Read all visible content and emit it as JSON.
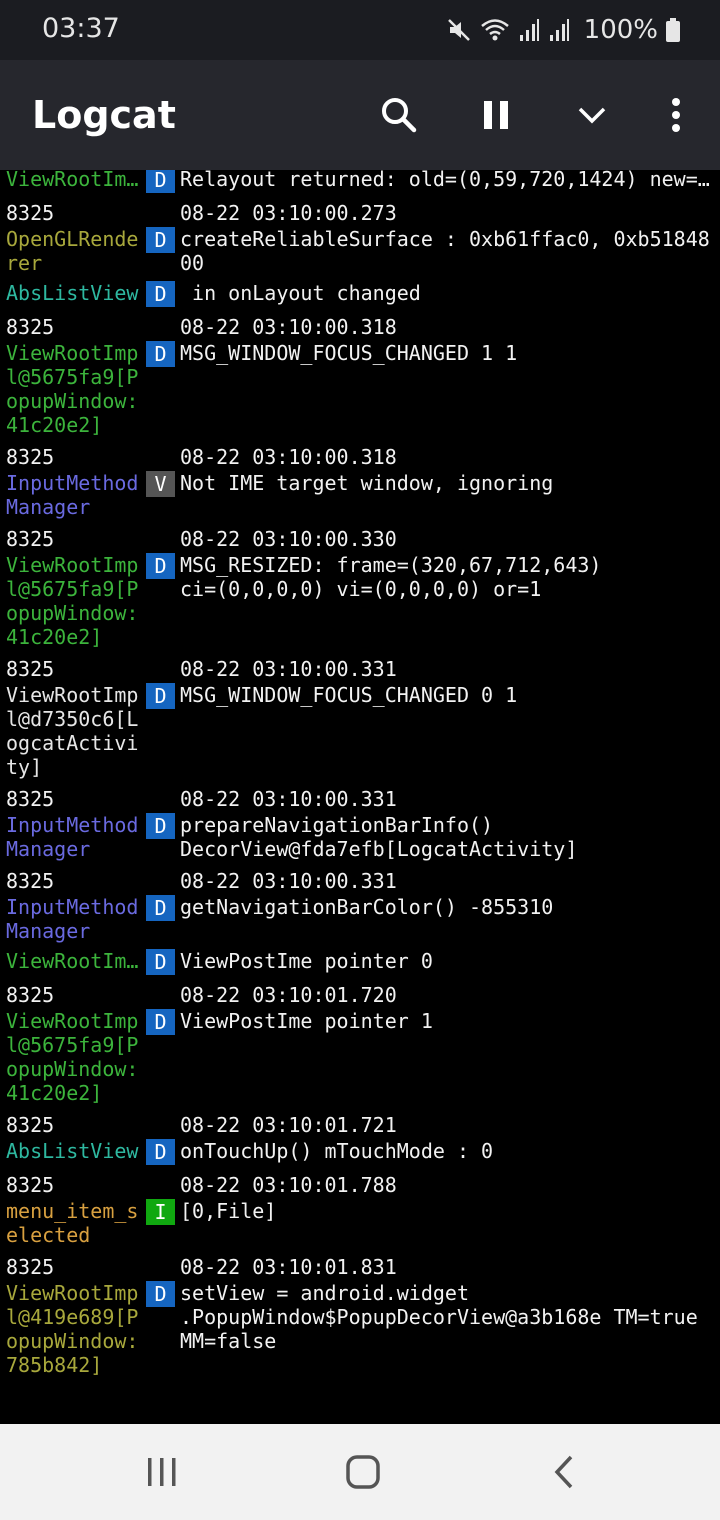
{
  "status_bar": {
    "time": "03:37",
    "battery": "100%",
    "icons": [
      "mute-icon",
      "wifi-icon",
      "signal-icon",
      "signal-icon",
      "battery-icon"
    ]
  },
  "app_bar": {
    "title": "Logcat",
    "icons": [
      "search-icon",
      "pause-icon",
      "chevron-down-icon",
      "more-vert-icon"
    ]
  },
  "level_colors": {
    "D": "#1565c0",
    "V": "#555555",
    "I": "#10a810"
  },
  "log_entries": [
    {
      "pid": "",
      "time": "",
      "tag": "ViewRootIm…",
      "tag_color": "#3cb43c",
      "level": "D",
      "message": "Relayout returned: old=(0,59,720,1424) new=…",
      "truncate": true
    },
    {
      "pid": "8325",
      "time": "08-22 03:10:00.273",
      "tag": "OpenGLRenderer",
      "tag_color": "#a8a83c",
      "level": "D",
      "message": "createReliableSurface : 0xb61ffac0, 0xb5184800"
    },
    {
      "pid": "",
      "time": "",
      "tag": "AbsListView",
      "tag_color": "#2eb8a0",
      "level": "D",
      "message": " in onLayout changed"
    },
    {
      "pid": "8325",
      "time": "08-22 03:10:00.318",
      "tag": "ViewRootImpl@5675fa9[PopupWindow:41c20e2]",
      "tag_color": "#3cb43c",
      "level": "D",
      "message": "MSG_WINDOW_FOCUS_CHANGED 1 1"
    },
    {
      "pid": "8325",
      "time": "08-22 03:10:00.318",
      "tag": "InputMethodManager",
      "tag_color": "#6a6ae0",
      "level": "V",
      "message": "Not IME target window, ignoring"
    },
    {
      "pid": "8325",
      "time": "08-22 03:10:00.330",
      "tag": "ViewRootImpl@5675fa9[PopupWindow:41c20e2]",
      "tag_color": "#3cb43c",
      "level": "D",
      "message": "MSG_RESIZED: frame=(320,67,712,643)\nci=(0,0,0,0) vi=(0,0,0,0) or=1"
    },
    {
      "pid": "8325",
      "time": "08-22 03:10:00.331",
      "tag": "ViewRootImpl@d7350c6[LogcatActivity]",
      "tag_color": "#e6e6e6",
      "level": "D",
      "message": "MSG_WINDOW_FOCUS_CHANGED 0 1"
    },
    {
      "pid": "8325",
      "time": "08-22 03:10:00.331",
      "tag": "InputMethodManager",
      "tag_color": "#6a6ae0",
      "level": "D",
      "message": "prepareNavigationBarInfo()\nDecorView@fda7efb[LogcatActivity]"
    },
    {
      "pid": "8325",
      "time": "08-22 03:10:00.331",
      "tag": "InputMethodManager",
      "tag_color": "#6a6ae0",
      "level": "D",
      "message": "getNavigationBarColor() -855310"
    },
    {
      "pid": "",
      "time": "",
      "tag": "ViewRootIm…",
      "tag_color": "#3cb43c",
      "level": "D",
      "message": "ViewPostIme pointer 0"
    },
    {
      "pid": "8325",
      "time": "08-22 03:10:01.720",
      "tag": "ViewRootImpl@5675fa9[PopupWindow:41c20e2]",
      "tag_color": "#3cb43c",
      "level": "D",
      "message": "ViewPostIme pointer 1"
    },
    {
      "pid": "8325",
      "time": "08-22 03:10:01.721",
      "tag": "AbsListView",
      "tag_color": "#2eb8a0",
      "level": "D",
      "message": "onTouchUp() mTouchMode : 0"
    },
    {
      "pid": "8325",
      "time": "08-22 03:10:01.788",
      "tag": "menu_item_selected",
      "tag_color": "#d8a040",
      "level": "I",
      "message": "[0,File]"
    },
    {
      "pid": "8325",
      "time": "08-22 03:10:01.831",
      "tag": "ViewRootImpl@419e689[PopupWindow:785b842]",
      "tag_color": "#a8a83c",
      "level": "D",
      "message": "setView = android.widget\n.PopupWindow$PopupDecorView@a3b168e TM=true\nMM=false"
    }
  ],
  "nav_bar": {
    "icons": [
      "recents-icon",
      "home-icon",
      "back-icon"
    ]
  }
}
